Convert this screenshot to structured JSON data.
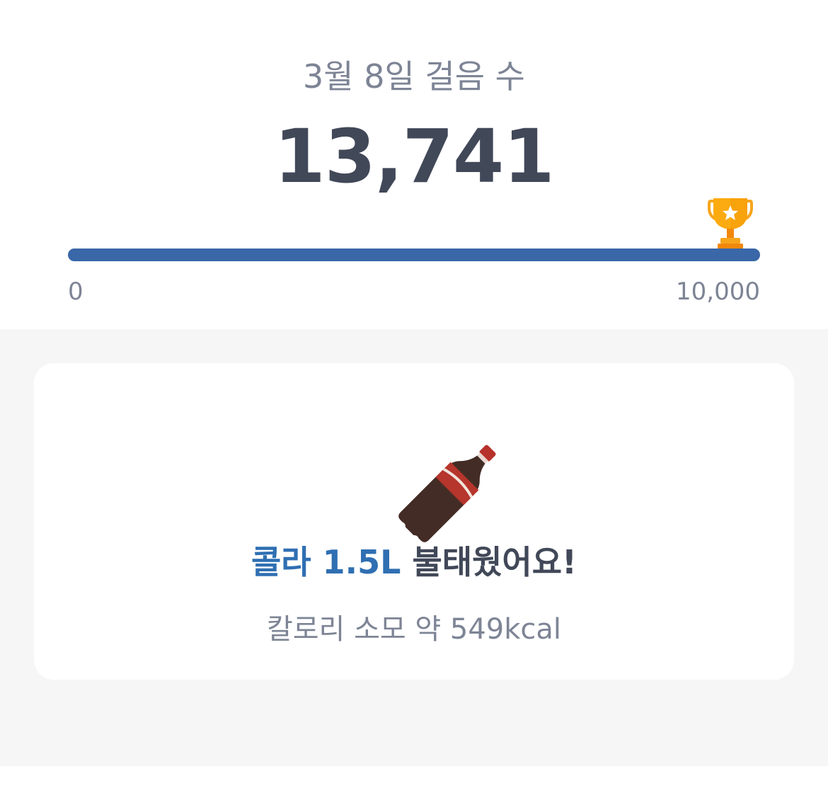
{
  "summary": {
    "date_title": "3월 8일 걸음 수",
    "step_count": "13,741"
  },
  "progress": {
    "fraction": 1.0,
    "min_label": "0",
    "max_label": "10,000",
    "fill_color": "#3a67a8",
    "goal_icon": "trophy-icon"
  },
  "card": {
    "icon": "cola-bottle-icon",
    "headline_accent": "콜라 1.5L",
    "headline_rest": " 불태웠어요!",
    "calorie_text": "칼로리 소모 약 549kcal",
    "accent_color": "#2f6fb2"
  }
}
